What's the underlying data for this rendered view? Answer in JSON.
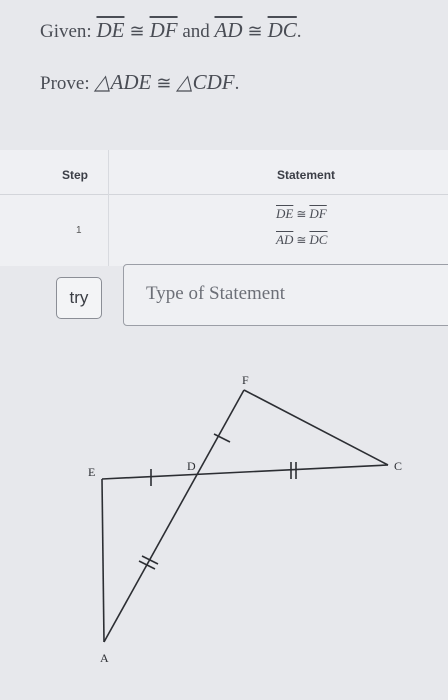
{
  "given": {
    "label": "Given:",
    "seg1": "DE",
    "cong1": "≅",
    "seg2": "DF",
    "and": "and",
    "seg3": "AD",
    "cong2": "≅",
    "seg4": "DC",
    "end": "."
  },
  "prove": {
    "label": "Prove:",
    "tri1": "△ADE",
    "cong": "≅",
    "tri2": "△CDF",
    "end": "."
  },
  "table": {
    "header_step": "Step",
    "header_statement": "Statement",
    "rows": [
      {
        "step": "1",
        "line1_a": "DE",
        "line1_cong": "≅",
        "line1_b": "DF",
        "line2_a": "AD",
        "line2_cong": "≅",
        "line2_b": "DC"
      }
    ]
  },
  "try_button": "try",
  "statement_input": {
    "placeholder": "Type of Statement"
  },
  "diagram": {
    "labels": {
      "E": "E",
      "D": "D",
      "F": "F",
      "C": "C",
      "A": "A"
    }
  }
}
